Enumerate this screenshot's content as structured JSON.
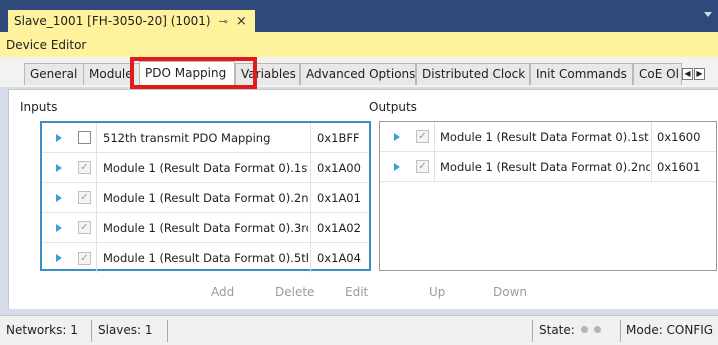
{
  "document_tab": {
    "title": "Slave_1001 [FH-3050-20] (1001)",
    "pin": "⊸",
    "close": "×"
  },
  "editor": {
    "title": "Device Editor"
  },
  "tabs": [
    {
      "label": "General"
    },
    {
      "label": "Module"
    },
    {
      "label": "PDO Mapping"
    },
    {
      "label": "Variables"
    },
    {
      "label": "Advanced Options"
    },
    {
      "label": "Distributed Clock"
    },
    {
      "label": "Init Commands"
    },
    {
      "label": "CoE Ol"
    }
  ],
  "inputs": {
    "label": "Inputs",
    "rows": [
      {
        "name": "512th transmit PDO Mapping",
        "index": "0x1BFF",
        "checked": false
      },
      {
        "name": "Module 1 (Result Data Format 0).1st",
        "index": "0x1A00",
        "checked": true
      },
      {
        "name": "Module 1 (Result Data Format 0).2nd",
        "index": "0x1A01",
        "checked": true
      },
      {
        "name": "Module 1 (Result Data Format 0).3rd",
        "index": "0x1A02",
        "checked": true
      },
      {
        "name": "Module 1 (Result Data Format 0).5th",
        "index": "0x1A04",
        "checked": true
      }
    ]
  },
  "outputs": {
    "label": "Outputs",
    "rows": [
      {
        "name": "Module 1 (Result Data Format 0).1st",
        "index": "0x1600",
        "checked": true
      },
      {
        "name": "Module 1 (Result Data Format 0).2nd",
        "index": "0x1601",
        "checked": true
      }
    ]
  },
  "actions": {
    "add": "Add",
    "delete": "Delete",
    "edit": "Edit",
    "up": "Up",
    "down": "Down"
  },
  "status": {
    "networks": "Networks: 1",
    "slaves": "Slaves: 1",
    "state": "State:",
    "mode": "Mode: CONFIG"
  },
  "colors": {
    "accent_yellow": "#fff29d",
    "strip_blue": "#2f4a7a",
    "highlight_red": "#e11a1a",
    "selection_blue": "#3a8ec8"
  }
}
